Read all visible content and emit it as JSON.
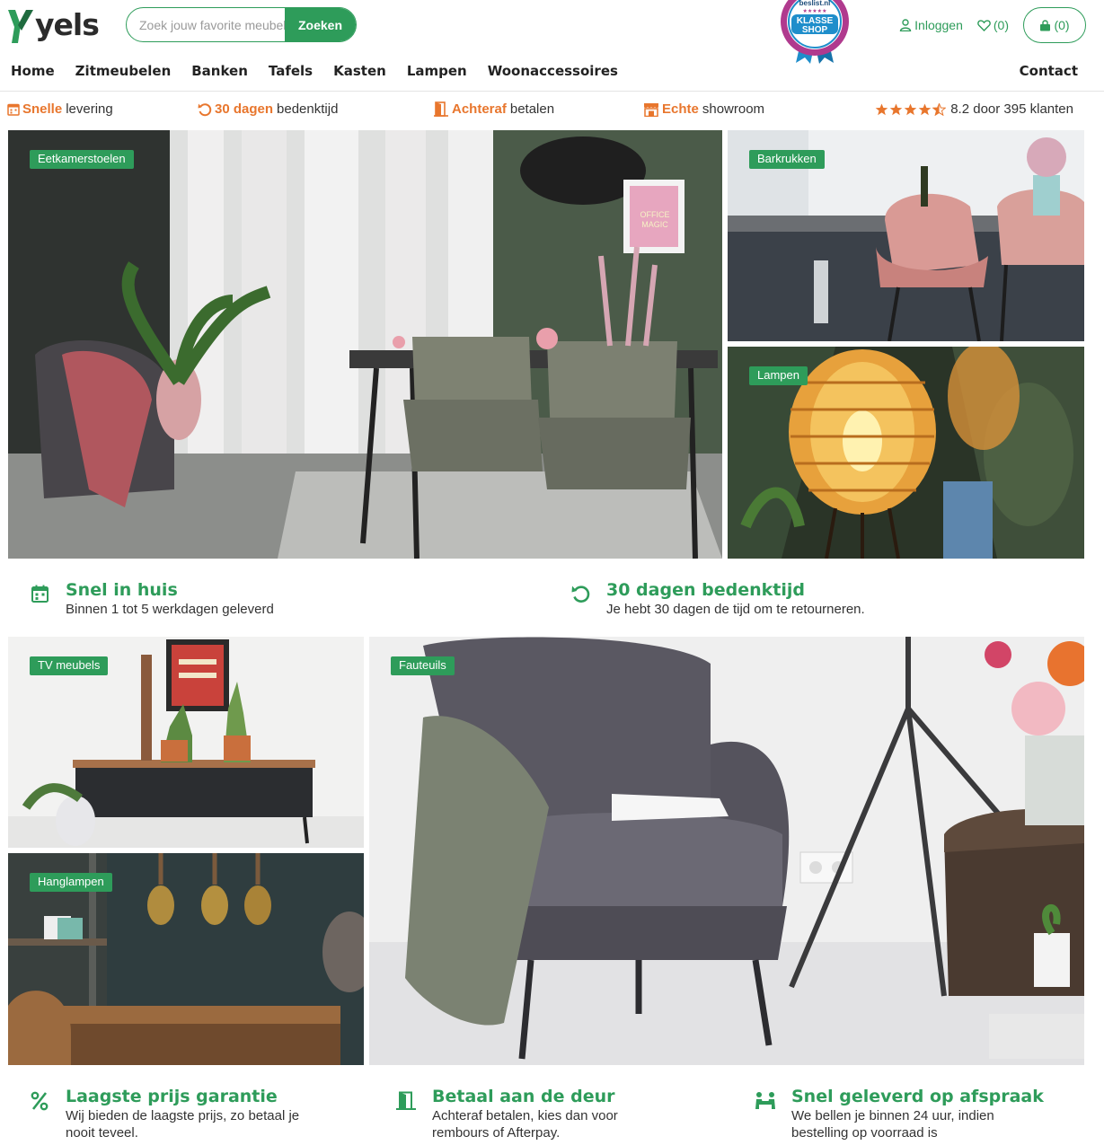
{
  "brand": {
    "logo_text": "yels",
    "accent_color": "#2e9c5a",
    "highlight_color": "#e8762d"
  },
  "search": {
    "placeholder": "Zoek jouw favorite meubel",
    "button_label": "Zoeken"
  },
  "seal": {
    "top_text": "beslist.nl",
    "line1": "KLASSE",
    "line2": "SHOP"
  },
  "account": {
    "login_label": "Inloggen",
    "wishlist_label": "(0)",
    "cart_label": "(0)"
  },
  "nav": {
    "items": [
      "Home",
      "Zitmeubelen",
      "Banken",
      "Tafels",
      "Kasten",
      "Lampen",
      "Woonaccessoires"
    ],
    "contact": "Contact"
  },
  "usps": [
    {
      "highlight": "Snelle",
      "text": "levering",
      "icon": "calendar-icon"
    },
    {
      "highlight": "30 dagen",
      "text": "bedenktijd",
      "icon": "undo-icon"
    },
    {
      "highlight": "Achteraf",
      "text": "betalen",
      "icon": "door-icon"
    },
    {
      "highlight": "Echte",
      "text": "showroom",
      "icon": "store-icon"
    }
  ],
  "rating": {
    "stars": 4.5,
    "text": "8.2 door 395 klanten"
  },
  "categories": {
    "eetkamerstoelen": "Eetkamerstoelen",
    "barkrukken": "Barkrukken",
    "lampen": "Lampen",
    "tv_meubels": "TV meubels",
    "hanglampen": "Hanglampen",
    "fauteuils": "Fauteuils"
  },
  "features_top": [
    {
      "title": "Snel in huis",
      "desc": "Binnen 1 tot 5 werkdagen geleverd",
      "icon": "calendar-icon"
    },
    {
      "title": "30 dagen bedenktijd",
      "desc": "Je hebt 30 dagen de tijd om te retourneren.",
      "icon": "undo-icon"
    }
  ],
  "features_bottom": [
    {
      "title": "Laagste prijs garantie",
      "desc1": "Wij bieden de laagste prijs, zo betaal je",
      "desc2": "nooit teveel.",
      "icon": "percent-icon"
    },
    {
      "title": "Betaal aan de deur",
      "desc1": "Achteraf betalen, kies dan voor",
      "desc2": "rembours of Afterpay.",
      "icon": "door-icon"
    },
    {
      "title": "Snel geleverd op afspraak",
      "desc1": "We bellen je binnen 24 uur, indien",
      "desc2": "bestelling op voorraad is",
      "icon": "delivery-icon"
    }
  ],
  "artwork": {
    "poster_text1": "OFFICE",
    "poster_text2": "MAGIC"
  }
}
